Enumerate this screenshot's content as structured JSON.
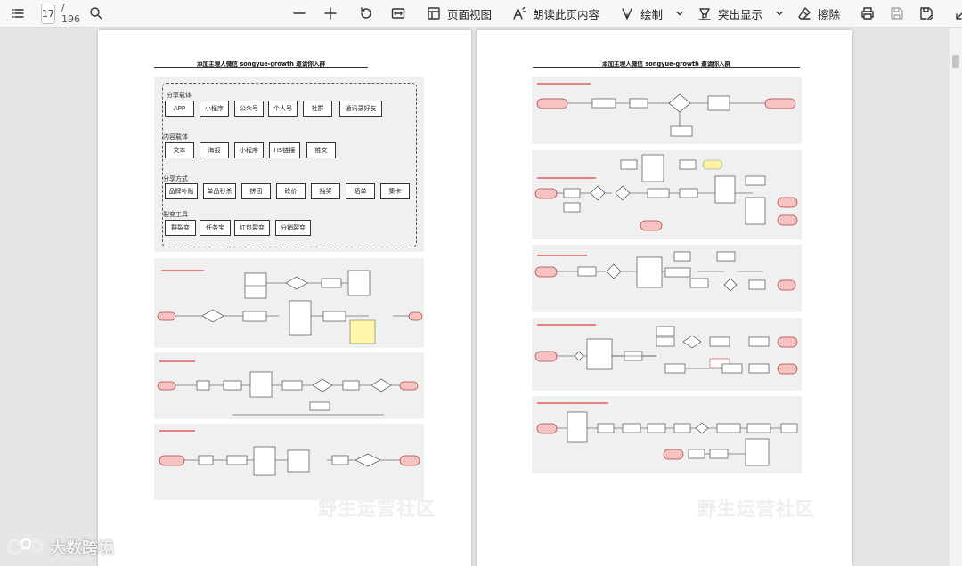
{
  "toolbar": {
    "page_current": "17",
    "page_total": "/ 196",
    "page_view_label": "页面视图",
    "read_aloud_label": "朗读此页内容",
    "draw_label": "绘制",
    "highlight_label": "突出显示",
    "erase_label": "擦除"
  },
  "left_page": {
    "title": "添加主理人微信 songyue-growth 邀请你入群",
    "watermark": "野生运营社区",
    "carrier_panel": {
      "groups": [
        {
          "label": "分享载体",
          "chips": [
            "APP",
            "小程序",
            "公众号",
            "个人号",
            "社群",
            "通讯录好友"
          ]
        },
        {
          "label": "内容载体",
          "chips": [
            "文本",
            "海报",
            "小程序",
            "H5链接",
            "推文"
          ]
        },
        {
          "label": "分享方式",
          "chips": [
            "品牌补贴",
            "单品秒杀",
            "拼团",
            "砍价",
            "抽奖",
            "晒单",
            "集卡"
          ]
        },
        {
          "label": "裂变工具",
          "chips": [
            "群裂变",
            "任务宝",
            "红包裂变",
            "分销裂变"
          ]
        }
      ]
    }
  },
  "right_page": {
    "title": "添加主理人微信 songyue-growth 邀请你入群",
    "watermark": "野生运营社区"
  },
  "logo": {
    "text": "大数跨境"
  }
}
